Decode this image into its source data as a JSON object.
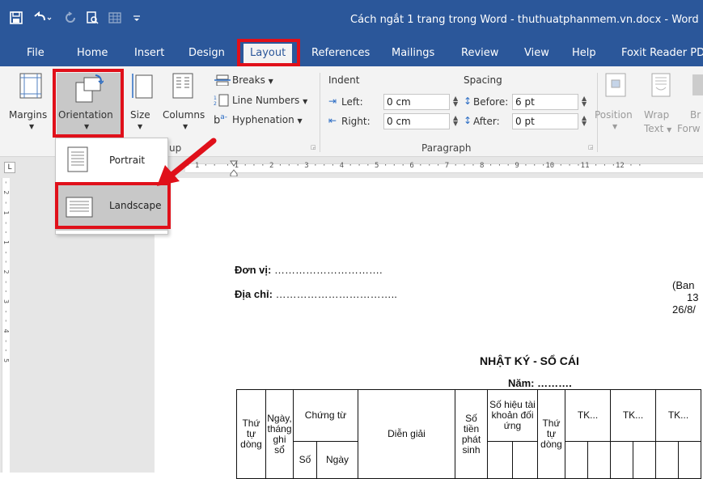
{
  "window": {
    "title": "Cách ngắt 1 trang trong Word - thuthuatphanmem.vn.docx  -  Word"
  },
  "quick_access": {
    "save_icon": "save-icon",
    "undo_icon": "undo-icon",
    "redo_icon": "redo-icon",
    "preview_icon": "print-preview-icon",
    "table_icon": "table-icon",
    "customize_icon": "customize-icon"
  },
  "tabs": {
    "file": "File",
    "home": "Home",
    "insert": "Insert",
    "design": "Design",
    "layout": "Layout",
    "references": "References",
    "mailings": "Mailings",
    "review": "Review",
    "view": "View",
    "help": "Help",
    "foxit": "Foxit Reader PD"
  },
  "ribbon": {
    "margins": "Margins",
    "orientation": "Orientation",
    "size": "Size",
    "columns": "Columns",
    "breaks": "Breaks",
    "line_numbers": "Line Numbers",
    "hyphenation": "Hyphenation",
    "page_setup_tail": "up",
    "indent": "Indent",
    "indent_left_label": "Left:",
    "indent_left_value": "0 cm",
    "indent_right_label": "Right:",
    "indent_right_value": "0 cm",
    "spacing": "Spacing",
    "spacing_before_label": "Before:",
    "spacing_before_value": "6 pt",
    "spacing_after_label": "After:",
    "spacing_after_value": "0 pt",
    "paragraph_group": "Paragraph",
    "position": "Position",
    "wrap": "Wrap",
    "wrap_text": "Text",
    "bring": "Br",
    "forward": "Forw"
  },
  "orientation_menu": {
    "portrait": "Portrait",
    "landscape": "Landscape"
  },
  "ruler": {
    "marks": "· 1 · ·  · 1 · · · 2 · · · 3 · · · 4 · · · 5 · · · 6 · · · 7 · · · 8 · · · 9 · · ·10 · · ·11 · · ·12 · ·",
    "vmarks": "- 2 - 1 - - 1 - - 2 - - 3 - - 4 - - 5",
    "corner": "L"
  },
  "document": {
    "don_vi_label": "Đơn vị:",
    "don_vi_dots": "………………………….",
    "dia_chi_label": "Địa chỉ:",
    "dia_chi_dots": "……………………………..",
    "ban_line1": "(Ban",
    "ban_line2": "13",
    "ban_line3": "26/8/",
    "heading": "NHẬT KÝ - SỔ CÁI",
    "nam": "Năm: ………."
  },
  "ledger": {
    "thu_tu_dong": "Thứ tự dòng",
    "ngay_thang": "Ngày, tháng ghi sổ",
    "chung_tu": "Chứng từ",
    "so": "Số",
    "ngay": "Ngày",
    "dien_giai": "Diễn giải",
    "so_tien": "Số tiền phát sinh",
    "so_hieu": "Số hiệu tài khoản đối ứng",
    "thu_tu_dong2": "Thứ tự dòng",
    "tk1": "TK...",
    "tk2": "TK...",
    "tk3": "TK..."
  },
  "colors": {
    "word_blue": "#2b579a",
    "highlight_red": "#e0101a",
    "ribbon_bg": "#f3f3f3"
  }
}
